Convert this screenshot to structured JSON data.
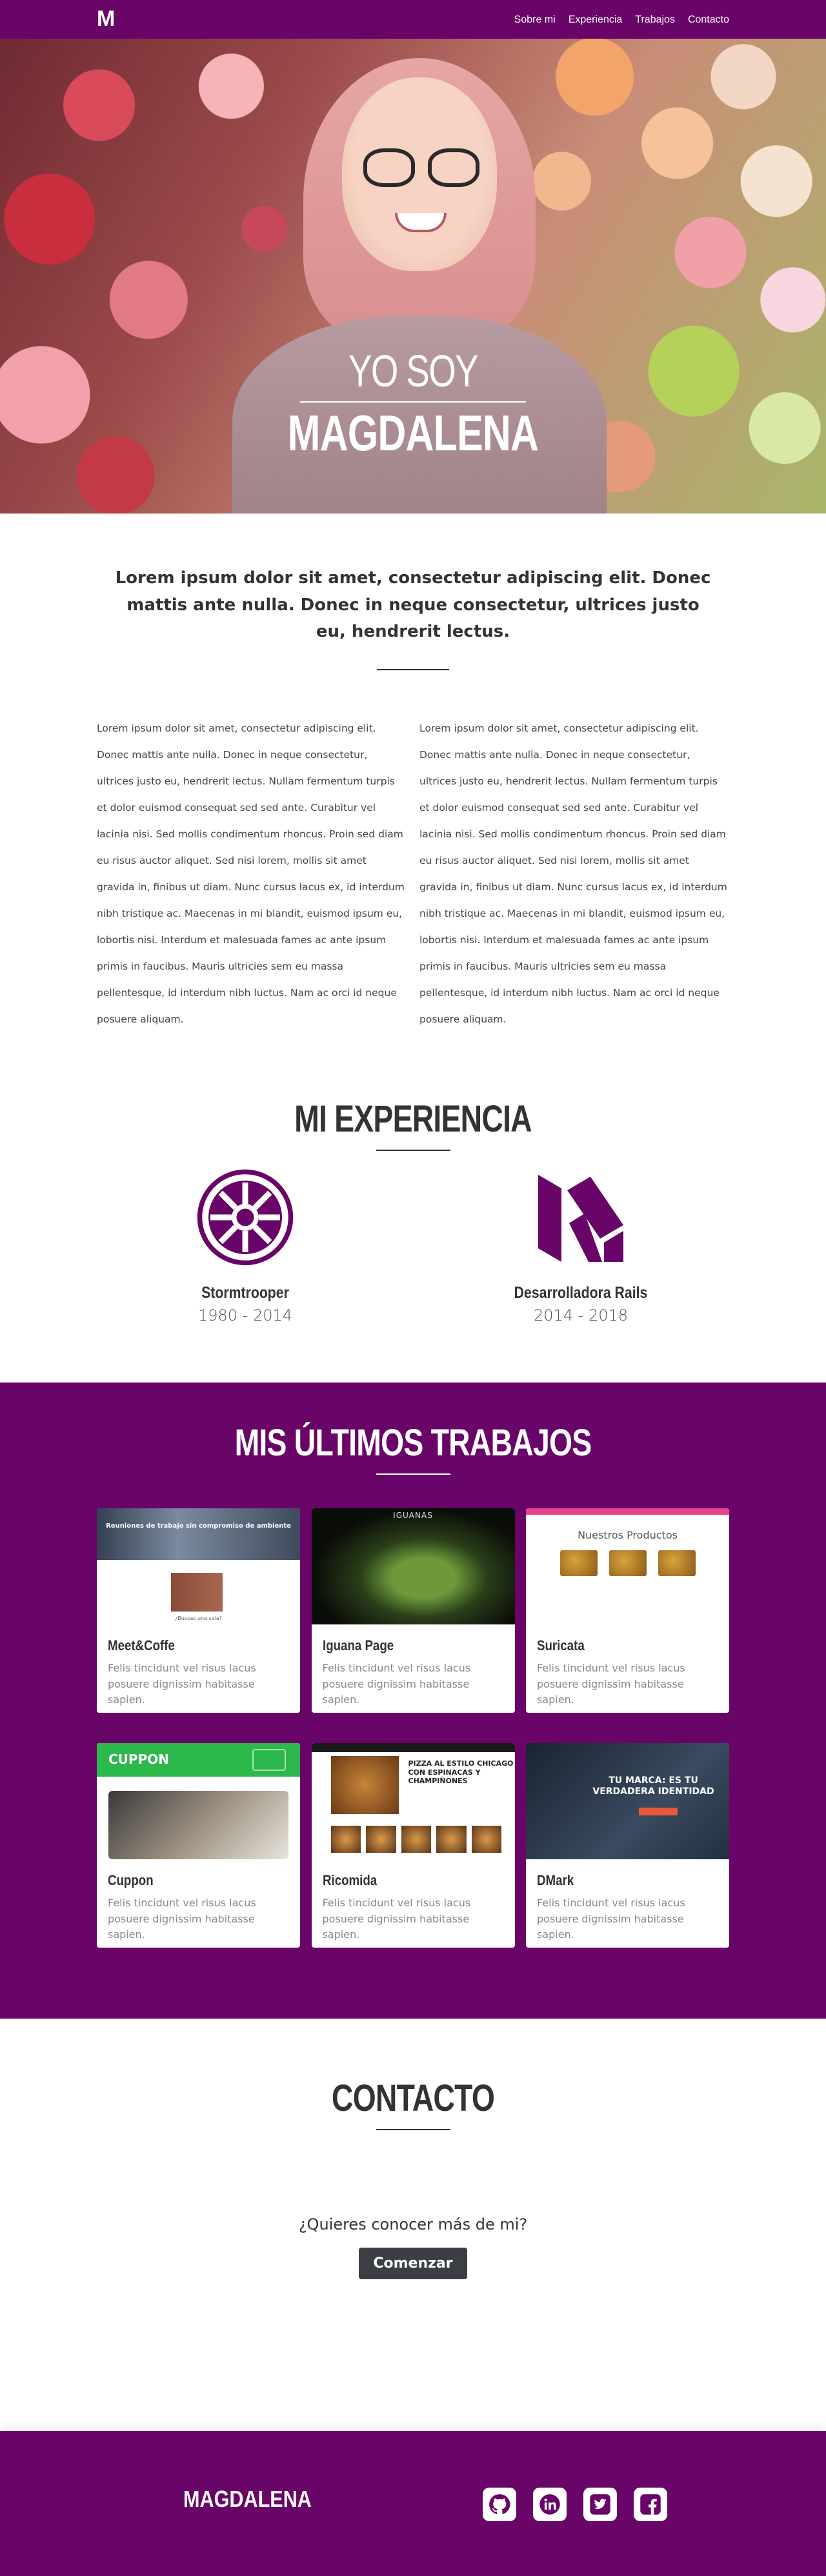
{
  "nav": {
    "brand": "M",
    "items": [
      "Sobre mi",
      "Experiencia",
      "Trabajos",
      "Contacto"
    ]
  },
  "hero": {
    "subtitle": "YO SOY",
    "title": "MAGDALENA"
  },
  "about": {
    "lead": "Lorem ipsum dolor sit amet, consectetur adipiscing elit. Donec mattis ante nulla. Donec in neque consectetur, ultrices justo eu, hendrerit lectus.",
    "col1": "Lorem ipsum dolor sit amet, consectetur adipiscing elit. Donec mattis ante nulla. Donec in neque consectetur, ultrices justo eu, hendrerit lectus. Nullam fermentum turpis et dolor euismod consequat sed sed ante. Curabitur vel lacinia nisi. Sed mollis condimentum rhoncus. Proin sed diam eu risus auctor aliquet. Sed nisi lorem, mollis sit amet gravida in, finibus ut diam. Nunc cursus lacus ex, id interdum nibh tristique ac. Maecenas in mi blandit, euismod ipsum eu, lobortis nisi. Interdum et malesuada fames ac ante ipsum primis in faucibus. Mauris ultricies sem eu massa pellentesque, id interdum nibh luctus. Nam ac orci id neque posuere aliquam.",
    "col2": "Lorem ipsum dolor sit amet, consectetur adipiscing elit. Donec mattis ante nulla. Donec in neque consectetur, ultrices justo eu, hendrerit lectus. Nullam fermentum turpis et dolor euismod consequat sed sed ante. Curabitur vel lacinia nisi. Sed mollis condimentum rhoncus. Proin sed diam eu risus auctor aliquet. Sed nisi lorem, mollis sit amet gravida in, finibus ut diam. Nunc cursus lacus ex, id interdum nibh tristique ac. Maecenas in mi blandit, euismod ipsum eu, lobortis nisi. Interdum et malesuada fames ac ante ipsum primis in faucibus. Mauris ultricies sem eu massa pellentesque, id interdum nibh luctus. Nam ac orci id neque posuere aliquam."
  },
  "experience": {
    "title": "MI EXPERIENCIA",
    "items": [
      {
        "name": "Stormtrooper",
        "years": "1980 - 2014",
        "icon": "galactic-empire-icon"
      },
      {
        "name": "Desarrolladora Rails",
        "years": "2014 - 2018",
        "icon": "m-logo-icon"
      }
    ]
  },
  "works": {
    "title": "MIS ÚLTIMOS TRABAJOS",
    "items": [
      {
        "name": "Meet&Coffe",
        "desc": "Felis tincidunt vel risus lacus posuere dignissim habitasse sapien.",
        "thumb_heading": "Reuniones de trabajo sin compromiso de ambiente",
        "thumb_caption": "¿Buscas una sala?"
      },
      {
        "name": "Iguana Page",
        "desc": "Felis tincidunt vel risus lacus posuere dignissim habitasse sapien.",
        "thumb_heading": "IGUANAS"
      },
      {
        "name": "Suricata",
        "desc": "Felis tincidunt vel risus lacus posuere dignissim habitasse sapien.",
        "thumb_heading": "Nuestros Productos"
      },
      {
        "name": "Cuppon",
        "desc": "Felis tincidunt vel risus lacus posuere dignissim habitasse sapien.",
        "thumb_heading": "CUPPON"
      },
      {
        "name": "Ricomida",
        "desc": "Felis tincidunt vel risus lacus posuere dignissim habitasse sapien.",
        "thumb_heading": "PIZZA AL ESTILO CHICAGO CON ESPINACAS Y CHAMPIÑONES"
      },
      {
        "name": "DMark",
        "desc": "Felis tincidunt vel risus lacus posuere dignissim habitasse sapien.",
        "thumb_heading": "TU MARCA: ES TU VERDADERA IDENTIDAD"
      }
    ]
  },
  "contact": {
    "title": "CONTACTO",
    "question": "¿Quieres conocer más de mi?",
    "button": "Comenzar"
  },
  "footer": {
    "brand": "MAGDALENA",
    "social": [
      "github-icon",
      "linkedin-icon",
      "twitter-icon",
      "facebook-icon"
    ]
  },
  "colors": {
    "brand_purple": "#690468",
    "button_dark": "#3b3e42"
  }
}
